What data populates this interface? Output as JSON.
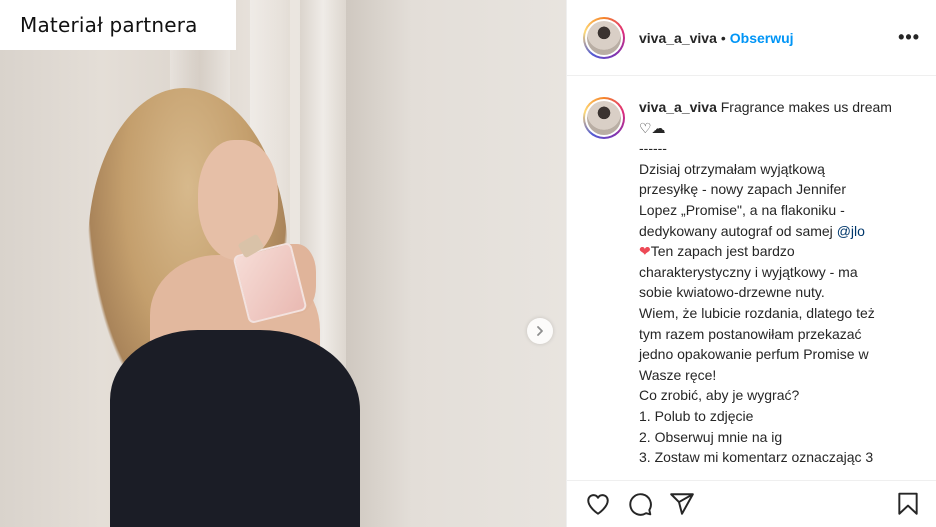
{
  "photo": {
    "partner_label": "Materiał partnera",
    "next_icon": "chevron-right-icon"
  },
  "header": {
    "username": "viva_a_viva",
    "separator": "•",
    "follow_label": "Obserwuj",
    "more_label": "•••"
  },
  "caption": {
    "username": "viva_a_viva",
    "lines": [
      "Fragrance makes us dream",
      "♡☁",
      "------",
      "Dzisiaj otrzymałam wyjątkową",
      "przesyłkę - nowy zapach Jennifer",
      "Lopez „Promise\", a na flakoniku -",
      "dedykowany autograf od samej"
    ],
    "mention": "@jlo",
    "heart": "❤",
    "lines2": [
      "Ten zapach jest bardzo",
      "charakterystyczny i wyjątkowy - ma",
      "sobie kwiatowo-drzewne nuty.",
      "Wiem, że lubicie rozdania, dlatego też",
      "tym razem postanowiłam przekazać",
      "jedno opakowanie perfum Promise w",
      "Wasze ręce!",
      "Co zrobić, aby je wygrać?",
      "1. Polub to zdjęcie",
      "2. Obserwuj mnie na ig",
      "3. Zostaw mi komentarz oznaczając 3"
    ]
  },
  "actions": {
    "icons": [
      "heart-icon",
      "comment-icon",
      "share-icon",
      "bookmark-icon"
    ]
  },
  "colors": {
    "accent": "#0095f6",
    "text": "#262626",
    "mention": "#00376b",
    "heart": "#ed4956"
  }
}
